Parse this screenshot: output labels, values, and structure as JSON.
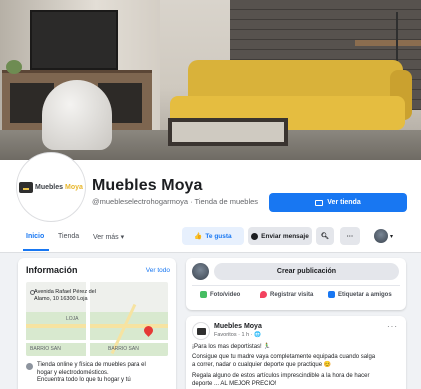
{
  "cover": {
    "alt": "cover-photo-living-room"
  },
  "page": {
    "name": "Muebles Moya",
    "handle": "@muebleselectrohogarmoya",
    "category": "Tienda de muebles",
    "logo_text_1": "Muebles",
    "logo_text_2": "Moya"
  },
  "header": {
    "primary_button": "Ver tienda",
    "tabs": [
      "Inicio",
      "Tienda",
      "Ver más"
    ],
    "like_button": "Te gusta",
    "message_button": "Enviar mensaje",
    "more_button": "···"
  },
  "info": {
    "title": "Información",
    "edit_link": "Ver todo",
    "address_line_1": "Avenida Rafael Pérez del",
    "address_line_2": "Alamo, 10 16300 Loja",
    "map_labels": [
      "LOJA",
      "BARRIO SAN",
      "BARRIO SAN"
    ],
    "description_1": "Tienda online y física de muebles para el",
    "description_2": "hogar y electrodomésticos.",
    "description_3": "Encuentra todo lo que tu hogar y tú"
  },
  "composer": {
    "button": "Crear publicación",
    "actions": [
      "Foto/video",
      "Registrar visita",
      "Etiquetar a amigos"
    ]
  },
  "post": {
    "author": "Muebles Moya",
    "meta": "Favoritos · 1 h · 🌐",
    "line_1": "¡Para los mas deportistas! 🏃‍♂️",
    "line_2": "Consigue que tu madre vaya completamente equipada cuando salga",
    "line_3": "a correr, nadar o cualquier deporte que practique 😊",
    "line_4": "Regala alguno de estos artículos imprescindible a la hora de hacer",
    "line_5": "deporte ... AL MEJOR PRECIO!"
  },
  "colors": {
    "accent": "#1877f2",
    "sofa": "#e5bd40"
  }
}
